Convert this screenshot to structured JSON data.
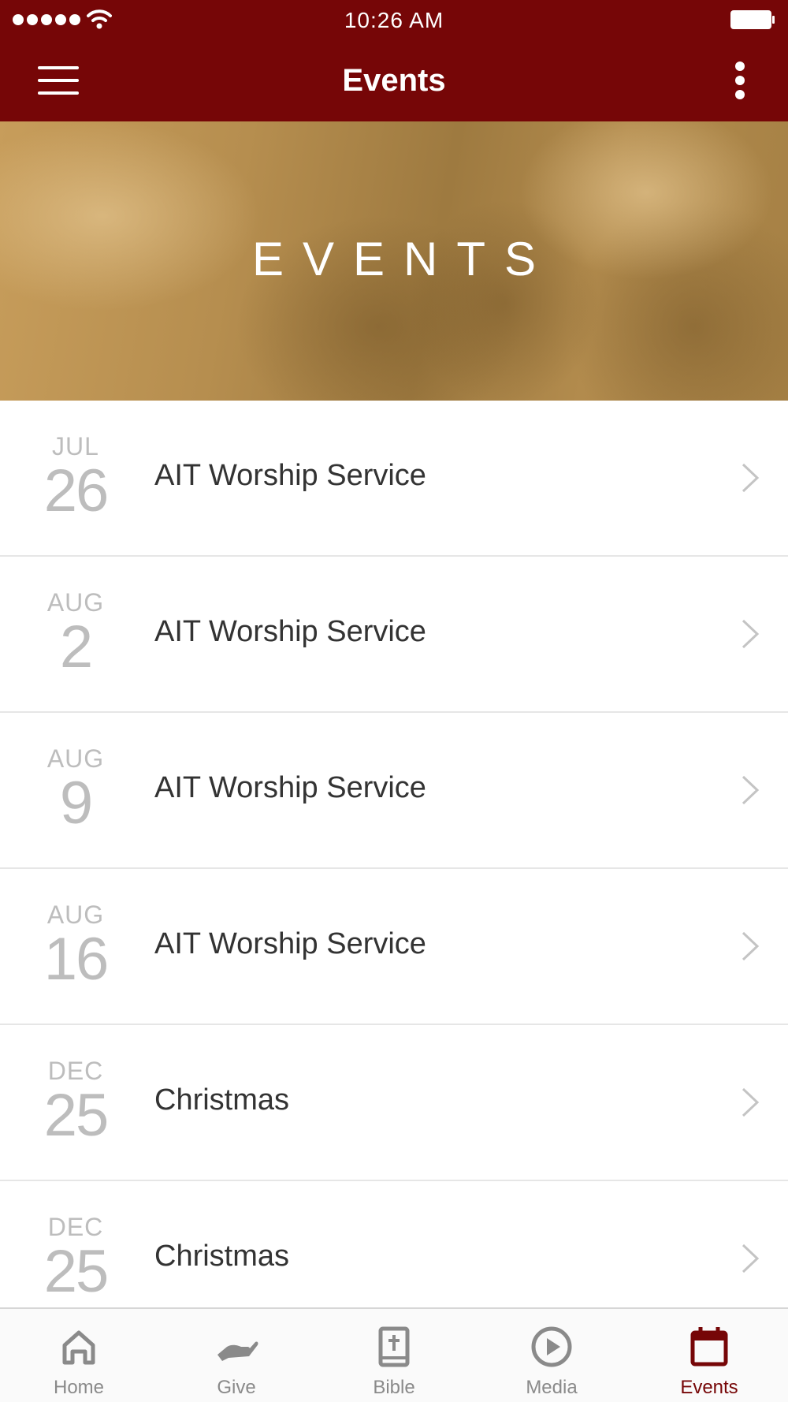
{
  "status_bar": {
    "time": "10:26 AM"
  },
  "nav": {
    "title": "Events"
  },
  "hero": {
    "title": "EVENTS"
  },
  "events": [
    {
      "month": "JUL",
      "day": "26",
      "title": "AIT Worship Service"
    },
    {
      "month": "AUG",
      "day": "2",
      "title": "AIT Worship Service"
    },
    {
      "month": "AUG",
      "day": "9",
      "title": "AIT Worship Service"
    },
    {
      "month": "AUG",
      "day": "16",
      "title": "AIT Worship Service"
    },
    {
      "month": "DEC",
      "day": "25",
      "title": "Christmas"
    },
    {
      "month": "DEC",
      "day": "25",
      "title": "Christmas"
    }
  ],
  "tabs": [
    {
      "label": "Home",
      "icon": "home-icon"
    },
    {
      "label": "Give",
      "icon": "give-icon"
    },
    {
      "label": "Bible",
      "icon": "bible-icon"
    },
    {
      "label": "Media",
      "icon": "media-play-icon"
    },
    {
      "label": "Events",
      "icon": "calendar-icon",
      "active": true
    }
  ],
  "colors": {
    "brand": "#760607",
    "tab_inactive": "#8a8a8a",
    "date_text": "#bdbdbd"
  }
}
